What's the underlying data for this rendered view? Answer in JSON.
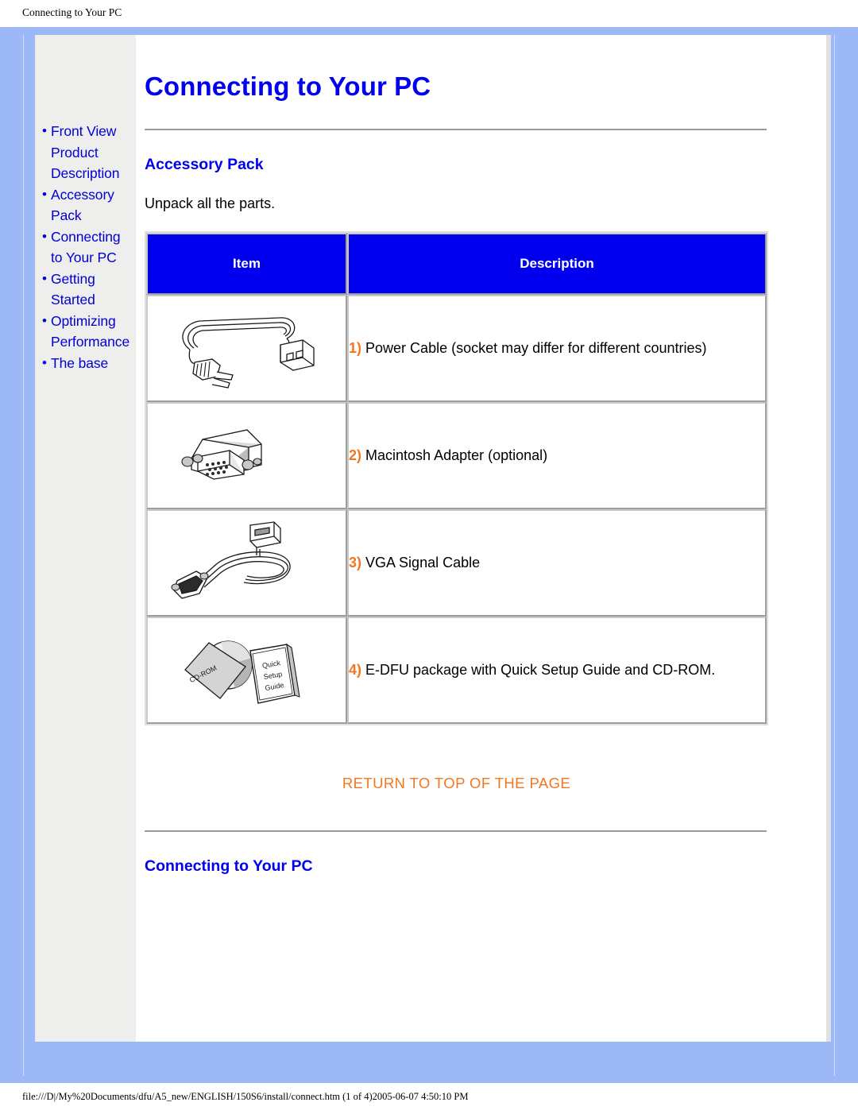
{
  "browser": {
    "print_header_title": "Connecting to Your PC",
    "print_footer_path": "file:///D|/My%20Documents/dfu/A5_new/ENGLISH/150S6/install/connect.htm (1 of 4)2005-06-07 4:50:10 PM"
  },
  "sidebar": {
    "items": [
      {
        "bullet": "•",
        "label": "Front View Product Description"
      },
      {
        "bullet": "•",
        "label": "Accessory Pack"
      },
      {
        "bullet": "•",
        "label": "Connecting to Your PC"
      },
      {
        "bullet": "•",
        "label": "Getting Started"
      },
      {
        "bullet": "•",
        "label": "Optimizing Performance"
      },
      {
        "bullet": "•",
        "label": "The base"
      }
    ]
  },
  "main": {
    "page_title": "Connecting to Your PC",
    "accessory_section": {
      "heading": "Accessory Pack",
      "intro": "Unpack all the parts.",
      "table": {
        "columns": [
          "Item",
          "Description"
        ],
        "rows": [
          {
            "icon": "power-cable-icon",
            "number": "1)",
            "description": "Power Cable (socket may differ for different countries)"
          },
          {
            "icon": "macintosh-adapter-icon",
            "number": "2)",
            "description": "Macintosh Adapter (optional)"
          },
          {
            "icon": "vga-signal-cable-icon",
            "number": "3)",
            "description": "VGA Signal Cable"
          },
          {
            "icon": "cdrom-package-icon",
            "number": "4)",
            "description": "E-DFU package with Quick Setup Guide and CD-ROM."
          }
        ]
      }
    },
    "return_link": "RETURN TO TOP OF THE PAGE",
    "connecting_section": {
      "heading": "Connecting to Your PC"
    },
    "image_labels": {
      "cdrom_disc_label": "CD-ROM",
      "quick_setup_guide_label": "Quick Setup Guide"
    }
  },
  "colors": {
    "frame_blue": "#9cb8f7",
    "link_blue": "#0000ee",
    "accent_orange": "#f4761f",
    "header_blue": "#0000ee",
    "sidebar_gray": "#eeeeed"
  }
}
